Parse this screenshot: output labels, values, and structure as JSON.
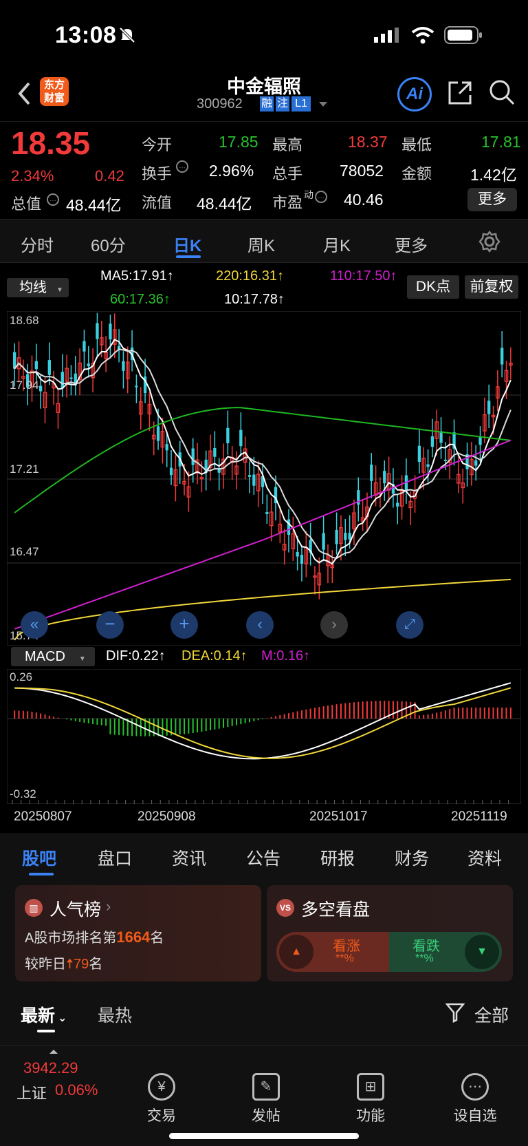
{
  "status_bar": {
    "time": "13:08"
  },
  "header": {
    "logo_line1": "东方",
    "logo_line2": "财富",
    "stock_name": "中金辐照",
    "stock_code": "300962",
    "badges": [
      "融",
      "注",
      "L1"
    ],
    "ai_label": "Ai"
  },
  "quote": {
    "price": "18.35",
    "change_pct": "2.34%",
    "change": "0.42",
    "open_label": "今开",
    "open": "17.85",
    "high_label": "最高",
    "high": "18.37",
    "low_label": "最低",
    "low": "17.81",
    "turnover_label": "换手",
    "turnover": "2.96%",
    "volume_label": "总手",
    "volume": "78052",
    "amount_label": "金额",
    "amount": "1.42亿",
    "mcap_label": "总值",
    "mcap": "48.44亿",
    "float_label": "流值",
    "float": "48.44亿",
    "pe_label": "市盈",
    "pe_sup": "动",
    "pe": "40.46",
    "more_label": "更多"
  },
  "period_tabs": [
    "分时",
    "60分",
    "日K",
    "周K",
    "月K",
    "更多"
  ],
  "active_period": "日K",
  "kline": {
    "indicator_select": "均线",
    "ma5": "MA5:17.91↑",
    "ma220": "220:16.31↑",
    "ma110": "110:17.50↑",
    "ma60": "60:17.36↑",
    "ma10": "10:17.78↑",
    "dk_label": "DK点",
    "adjust_label": "前复权",
    "price_ticks": [
      "18.68",
      "17.94",
      "17.21",
      "16.47",
      "15.74"
    ]
  },
  "macd": {
    "select": "MACD",
    "dif": "DIF:0.22↑",
    "dea": "DEA:0.14↑",
    "m": "M:0.16↑",
    "ticks": [
      "0.26",
      "-0.32"
    ],
    "dates": [
      "20250807",
      "20250908",
      "20251017",
      "20251119"
    ]
  },
  "section_tabs": [
    "股吧",
    "盘口",
    "资讯",
    "公告",
    "研报",
    "财务",
    "资料"
  ],
  "active_section": "股吧",
  "popularity": {
    "title": "人气榜",
    "line1_pre": "A股市场排名第",
    "rank": "1664",
    "line1_post": "名",
    "line2_pre": "较昨日",
    "delta": "79",
    "line2_post": "名"
  },
  "sentiment": {
    "title": "多空看盘",
    "up_label": "看涨",
    "up_value": "**%",
    "down_label": "看跌",
    "down_value": "**%"
  },
  "feed_tabs": {
    "latest": "最新",
    "hot": "最热",
    "filter": "全部"
  },
  "bottom_nav": {
    "index_value": "3942.29",
    "index_name": "上证",
    "index_change": "0.06%",
    "items": [
      "交易",
      "发帖",
      "功能",
      "设自选"
    ]
  },
  "colors": {
    "up": "#f23a3a",
    "down": "#27c22d",
    "accent": "#3b82f6"
  }
}
